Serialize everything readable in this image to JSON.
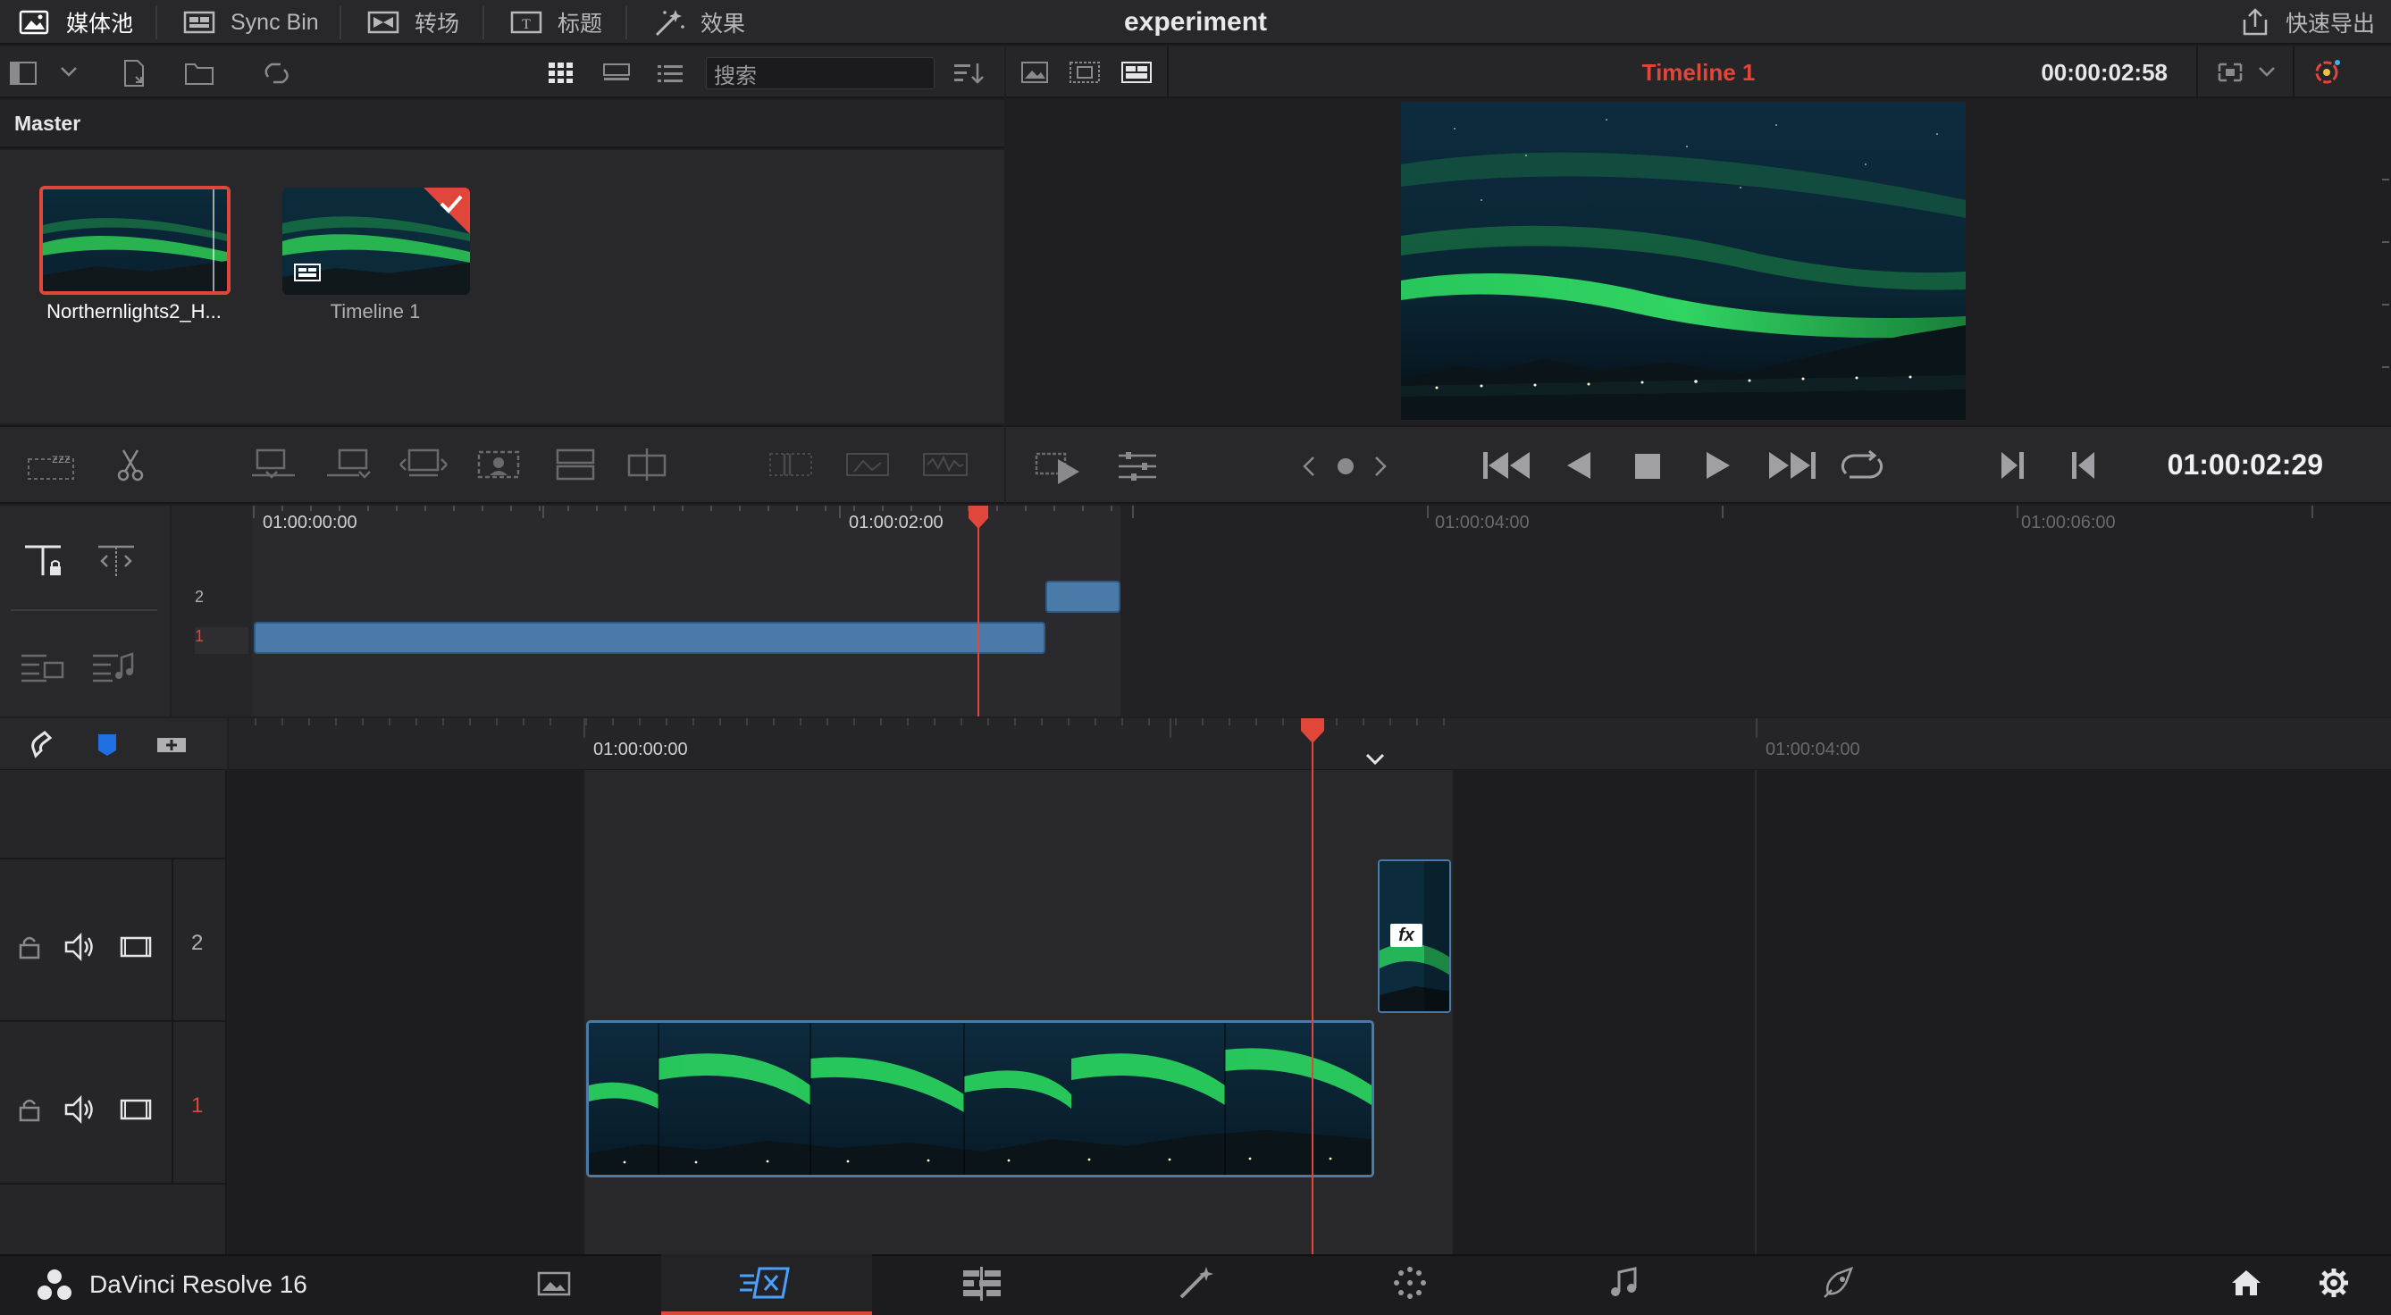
{
  "topbar": {
    "items": [
      {
        "label": "媒体池",
        "icon": "media-pool-icon",
        "active": true
      },
      {
        "label": "Sync Bin",
        "icon": "sync-bin-icon",
        "active": false
      },
      {
        "label": "转场",
        "icon": "transitions-icon",
        "active": false
      },
      {
        "label": "标题",
        "icon": "titles-icon",
        "active": false
      },
      {
        "label": "效果",
        "icon": "effects-icon",
        "active": false
      }
    ],
    "project_title": "experiment",
    "quick_export": "快速导出"
  },
  "media_pool": {
    "search_placeholder": "搜索",
    "bin_name": "Master",
    "clips": [
      {
        "label": "Northernlights2_H...",
        "selected": true
      },
      {
        "label": "Timeline 1",
        "selected": false
      }
    ]
  },
  "viewer": {
    "timeline_name": "Timeline 1",
    "duration": "00:00:02:58",
    "current_timecode": "01:00:02:29"
  },
  "upper_timeline": {
    "ruler": [
      "01:00:00:00",
      "01:00:02:00",
      "01:00:04:00",
      "01:00:06:00"
    ],
    "tracks": [
      "2",
      "1"
    ]
  },
  "lower_timeline": {
    "ruler": [
      "01:00:00:00",
      "01:00:04:00"
    ],
    "tracks": [
      {
        "number": "2"
      },
      {
        "number": "1"
      }
    ],
    "fx_label": "fx"
  },
  "bottombar": {
    "app_name": "DaVinci Resolve 16"
  },
  "colors": {
    "accent_red": "#e0463a",
    "clip_blue": "#4a7aa8",
    "selected_border": "#e0463a"
  }
}
